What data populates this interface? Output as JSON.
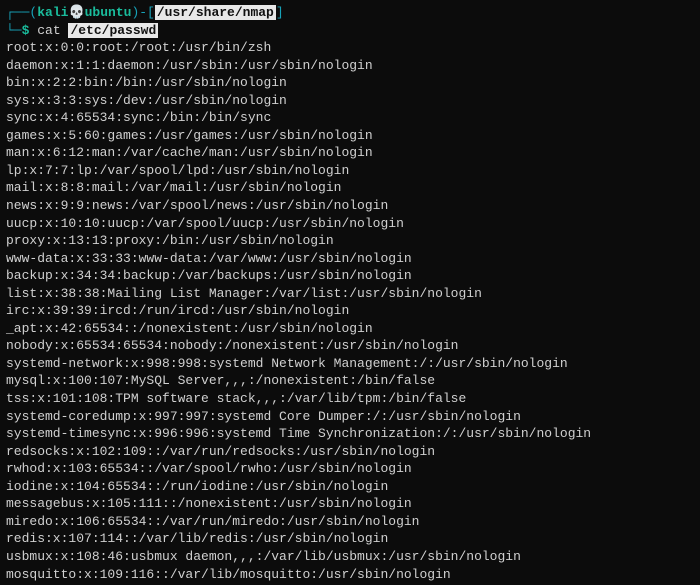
{
  "prompt": {
    "corner_top": "┌──(",
    "user": "kali",
    "separator_glyph": "💀",
    "host": "ubuntu",
    "close_paren": ")-[",
    "cwd": "/usr/share/nmap",
    "close_bracket": "]",
    "corner_bottom": "└─",
    "symbol": "$",
    "command": "cat",
    "argument": "/etc/passwd"
  },
  "output": [
    "root:x:0:0:root:/root:/usr/bin/zsh",
    "daemon:x:1:1:daemon:/usr/sbin:/usr/sbin/nologin",
    "bin:x:2:2:bin:/bin:/usr/sbin/nologin",
    "sys:x:3:3:sys:/dev:/usr/sbin/nologin",
    "sync:x:4:65534:sync:/bin:/bin/sync",
    "games:x:5:60:games:/usr/games:/usr/sbin/nologin",
    "man:x:6:12:man:/var/cache/man:/usr/sbin/nologin",
    "lp:x:7:7:lp:/var/spool/lpd:/usr/sbin/nologin",
    "mail:x:8:8:mail:/var/mail:/usr/sbin/nologin",
    "news:x:9:9:news:/var/spool/news:/usr/sbin/nologin",
    "uucp:x:10:10:uucp:/var/spool/uucp:/usr/sbin/nologin",
    "proxy:x:13:13:proxy:/bin:/usr/sbin/nologin",
    "www-data:x:33:33:www-data:/var/www:/usr/sbin/nologin",
    "backup:x:34:34:backup:/var/backups:/usr/sbin/nologin",
    "list:x:38:38:Mailing List Manager:/var/list:/usr/sbin/nologin",
    "irc:x:39:39:ircd:/run/ircd:/usr/sbin/nologin",
    "_apt:x:42:65534::/nonexistent:/usr/sbin/nologin",
    "nobody:x:65534:65534:nobody:/nonexistent:/usr/sbin/nologin",
    "systemd-network:x:998:998:systemd Network Management:/:/usr/sbin/nologin",
    "mysql:x:100:107:MySQL Server,,,:/nonexistent:/bin/false",
    "tss:x:101:108:TPM software stack,,,:/var/lib/tpm:/bin/false",
    "systemd-coredump:x:997:997:systemd Core Dumper:/:/usr/sbin/nologin",
    "systemd-timesync:x:996:996:systemd Time Synchronization:/:/usr/sbin/nologin",
    "redsocks:x:102:109::/var/run/redsocks:/usr/sbin/nologin",
    "rwhod:x:103:65534::/var/spool/rwho:/usr/sbin/nologin",
    "iodine:x:104:65534::/run/iodine:/usr/sbin/nologin",
    "messagebus:x:105:111::/nonexistent:/usr/sbin/nologin",
    "miredo:x:106:65534::/var/run/miredo:/usr/sbin/nologin",
    "redis:x:107:114::/var/lib/redis:/usr/sbin/nologin",
    "usbmux:x:108:46:usbmux daemon,,,:/var/lib/usbmux:/usr/sbin/nologin",
    "mosquitto:x:109:116::/var/lib/mosquitto:/usr/sbin/nologin"
  ]
}
